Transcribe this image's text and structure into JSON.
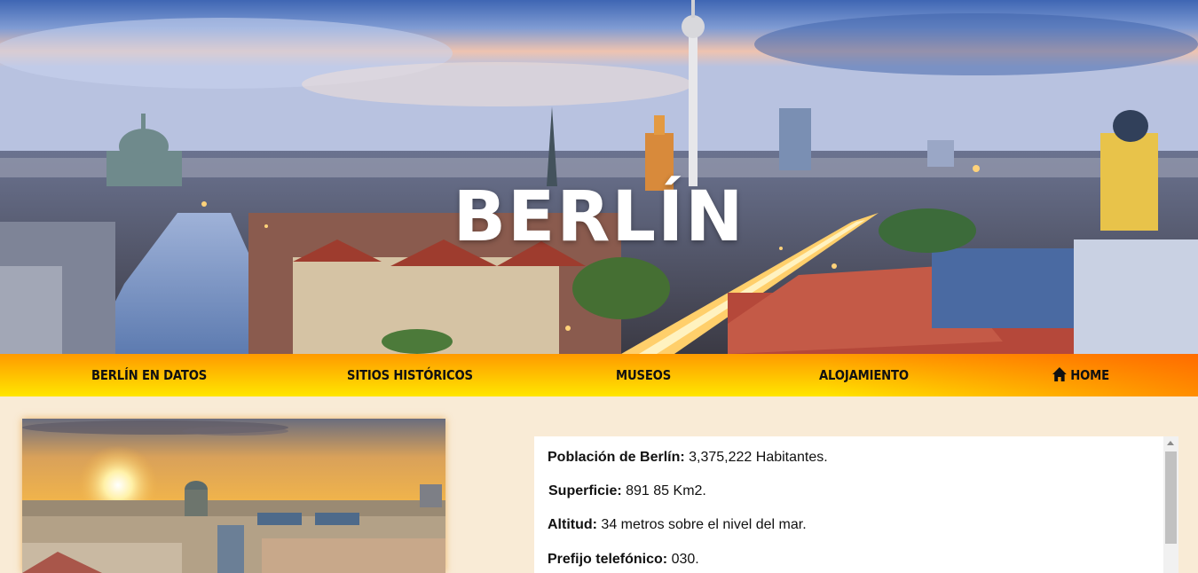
{
  "hero": {
    "title": "BERLÍN"
  },
  "nav": {
    "items": [
      {
        "label": "BERLÍN EN DATOS"
      },
      {
        "label": "SITIOS HISTÓRICOS"
      },
      {
        "label": "MUSEOS"
      },
      {
        "label": "ALOJAMIENTO"
      },
      {
        "label": "HOME",
        "icon": "home-icon"
      }
    ]
  },
  "facts": [
    {
      "label": "Población de Berlín:",
      "value": " 3,375,222 Habitantes."
    },
    {
      "label": "Superficie:",
      "value": " 891 85 Km2."
    },
    {
      "label": "Altitud:",
      "value": " 34 metros sobre el nivel del mar."
    },
    {
      "label": "Prefijo telefónico:",
      "value": " 030."
    }
  ],
  "colors": {
    "page_bg": "#f9ebd6",
    "nav_start": "#ff9a00",
    "nav_end": "#ffe600",
    "accent": "#ff6a00"
  }
}
